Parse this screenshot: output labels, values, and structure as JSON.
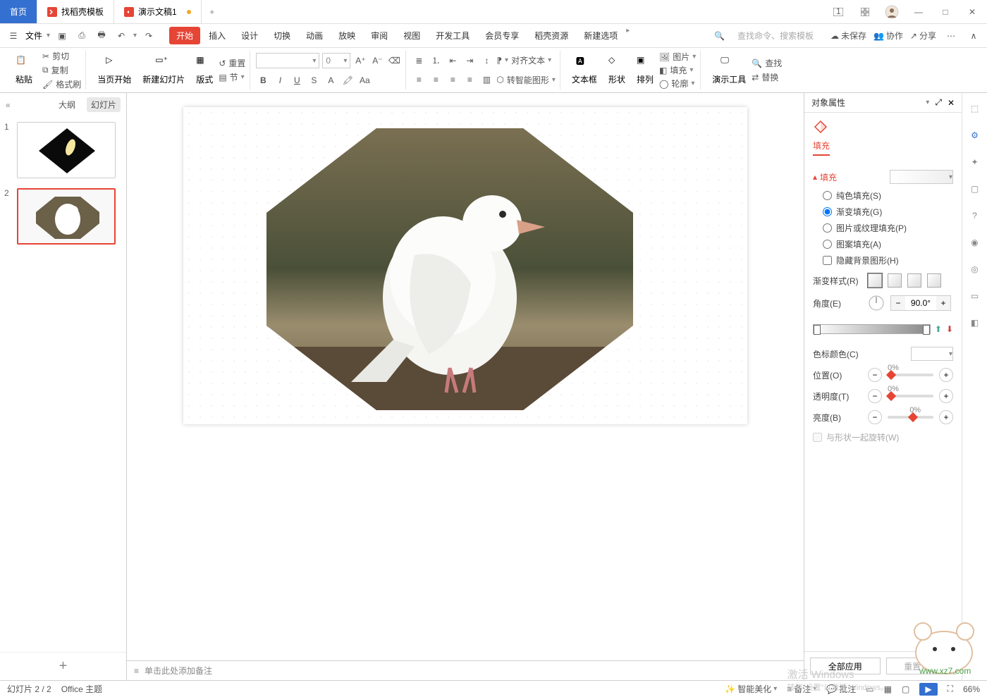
{
  "titlebar": {
    "home_tab": "首页",
    "template_tab": "找稻壳模板",
    "doc_tab": "演示文稿1",
    "new_tab_glyph": "+"
  },
  "window_controls": {
    "min": "—",
    "max": "□",
    "close": "✕"
  },
  "menubar": {
    "file_label": "文件",
    "tabs": [
      "开始",
      "插入",
      "设计",
      "切换",
      "动画",
      "放映",
      "审阅",
      "视图",
      "开发工具",
      "会员专享",
      "稻壳资源",
      "新建选项"
    ],
    "search_placeholder": "查找命令、搜索模板",
    "unsaved": "未保存",
    "collab": "协作",
    "share": "分享"
  },
  "ribbon": {
    "paste": "粘贴",
    "cut": "剪切",
    "copy": "复制",
    "format_painter": "格式刷",
    "from_current": "当页开始",
    "new_slide": "新建幻灯片",
    "layout": "版式",
    "reset": "重置",
    "section": "节",
    "font_size": "0",
    "align_text": "对齐文本",
    "convert_smart": "转智能图形",
    "textbox": "文本框",
    "shape": "形状",
    "arrange": "排列",
    "picture": "图片",
    "fill": "填充",
    "outline": "轮廓",
    "present_tool": "演示工具",
    "find": "查找",
    "replace": "替换"
  },
  "slide_panel": {
    "collapse": "«",
    "tab_outline": "大纲",
    "tab_slides": "幻灯片",
    "slides": [
      {
        "num": "1"
      },
      {
        "num": "2"
      }
    ],
    "add": "+"
  },
  "notes_placeholder": "单击此处添加备注",
  "props": {
    "header": "对象属性",
    "tab_fill": "填充",
    "section_fill": "填充",
    "opt_solid": "纯色填充(S)",
    "opt_gradient": "渐变填充(G)",
    "opt_picture": "图片或纹理填充(P)",
    "opt_pattern": "图案填充(A)",
    "opt_hidebg": "隐藏背景图形(H)",
    "gradient_style": "渐变样式(R)",
    "angle": "角度(E)",
    "angle_val": "90.0°",
    "stop_color": "色标颜色(C)",
    "position": "位置(O)",
    "position_val": "0%",
    "transparency": "透明度(T)",
    "transparency_val": "0%",
    "brightness": "亮度(B)",
    "brightness_val": "0%",
    "rotate_with_shape": "与形状一起旋转(W)",
    "apply_all": "全部应用",
    "reset_bg": "重置背景"
  },
  "statusbar": {
    "slide_pos": "幻灯片 2 / 2",
    "theme": "Office 主题",
    "beautify": "智能美化",
    "notes": "备注",
    "comments": "批注",
    "zoom": "66%"
  },
  "watermark": {
    "line1": "激活 Windows",
    "line2": "转到\"设置\"以激活 Windows。"
  }
}
